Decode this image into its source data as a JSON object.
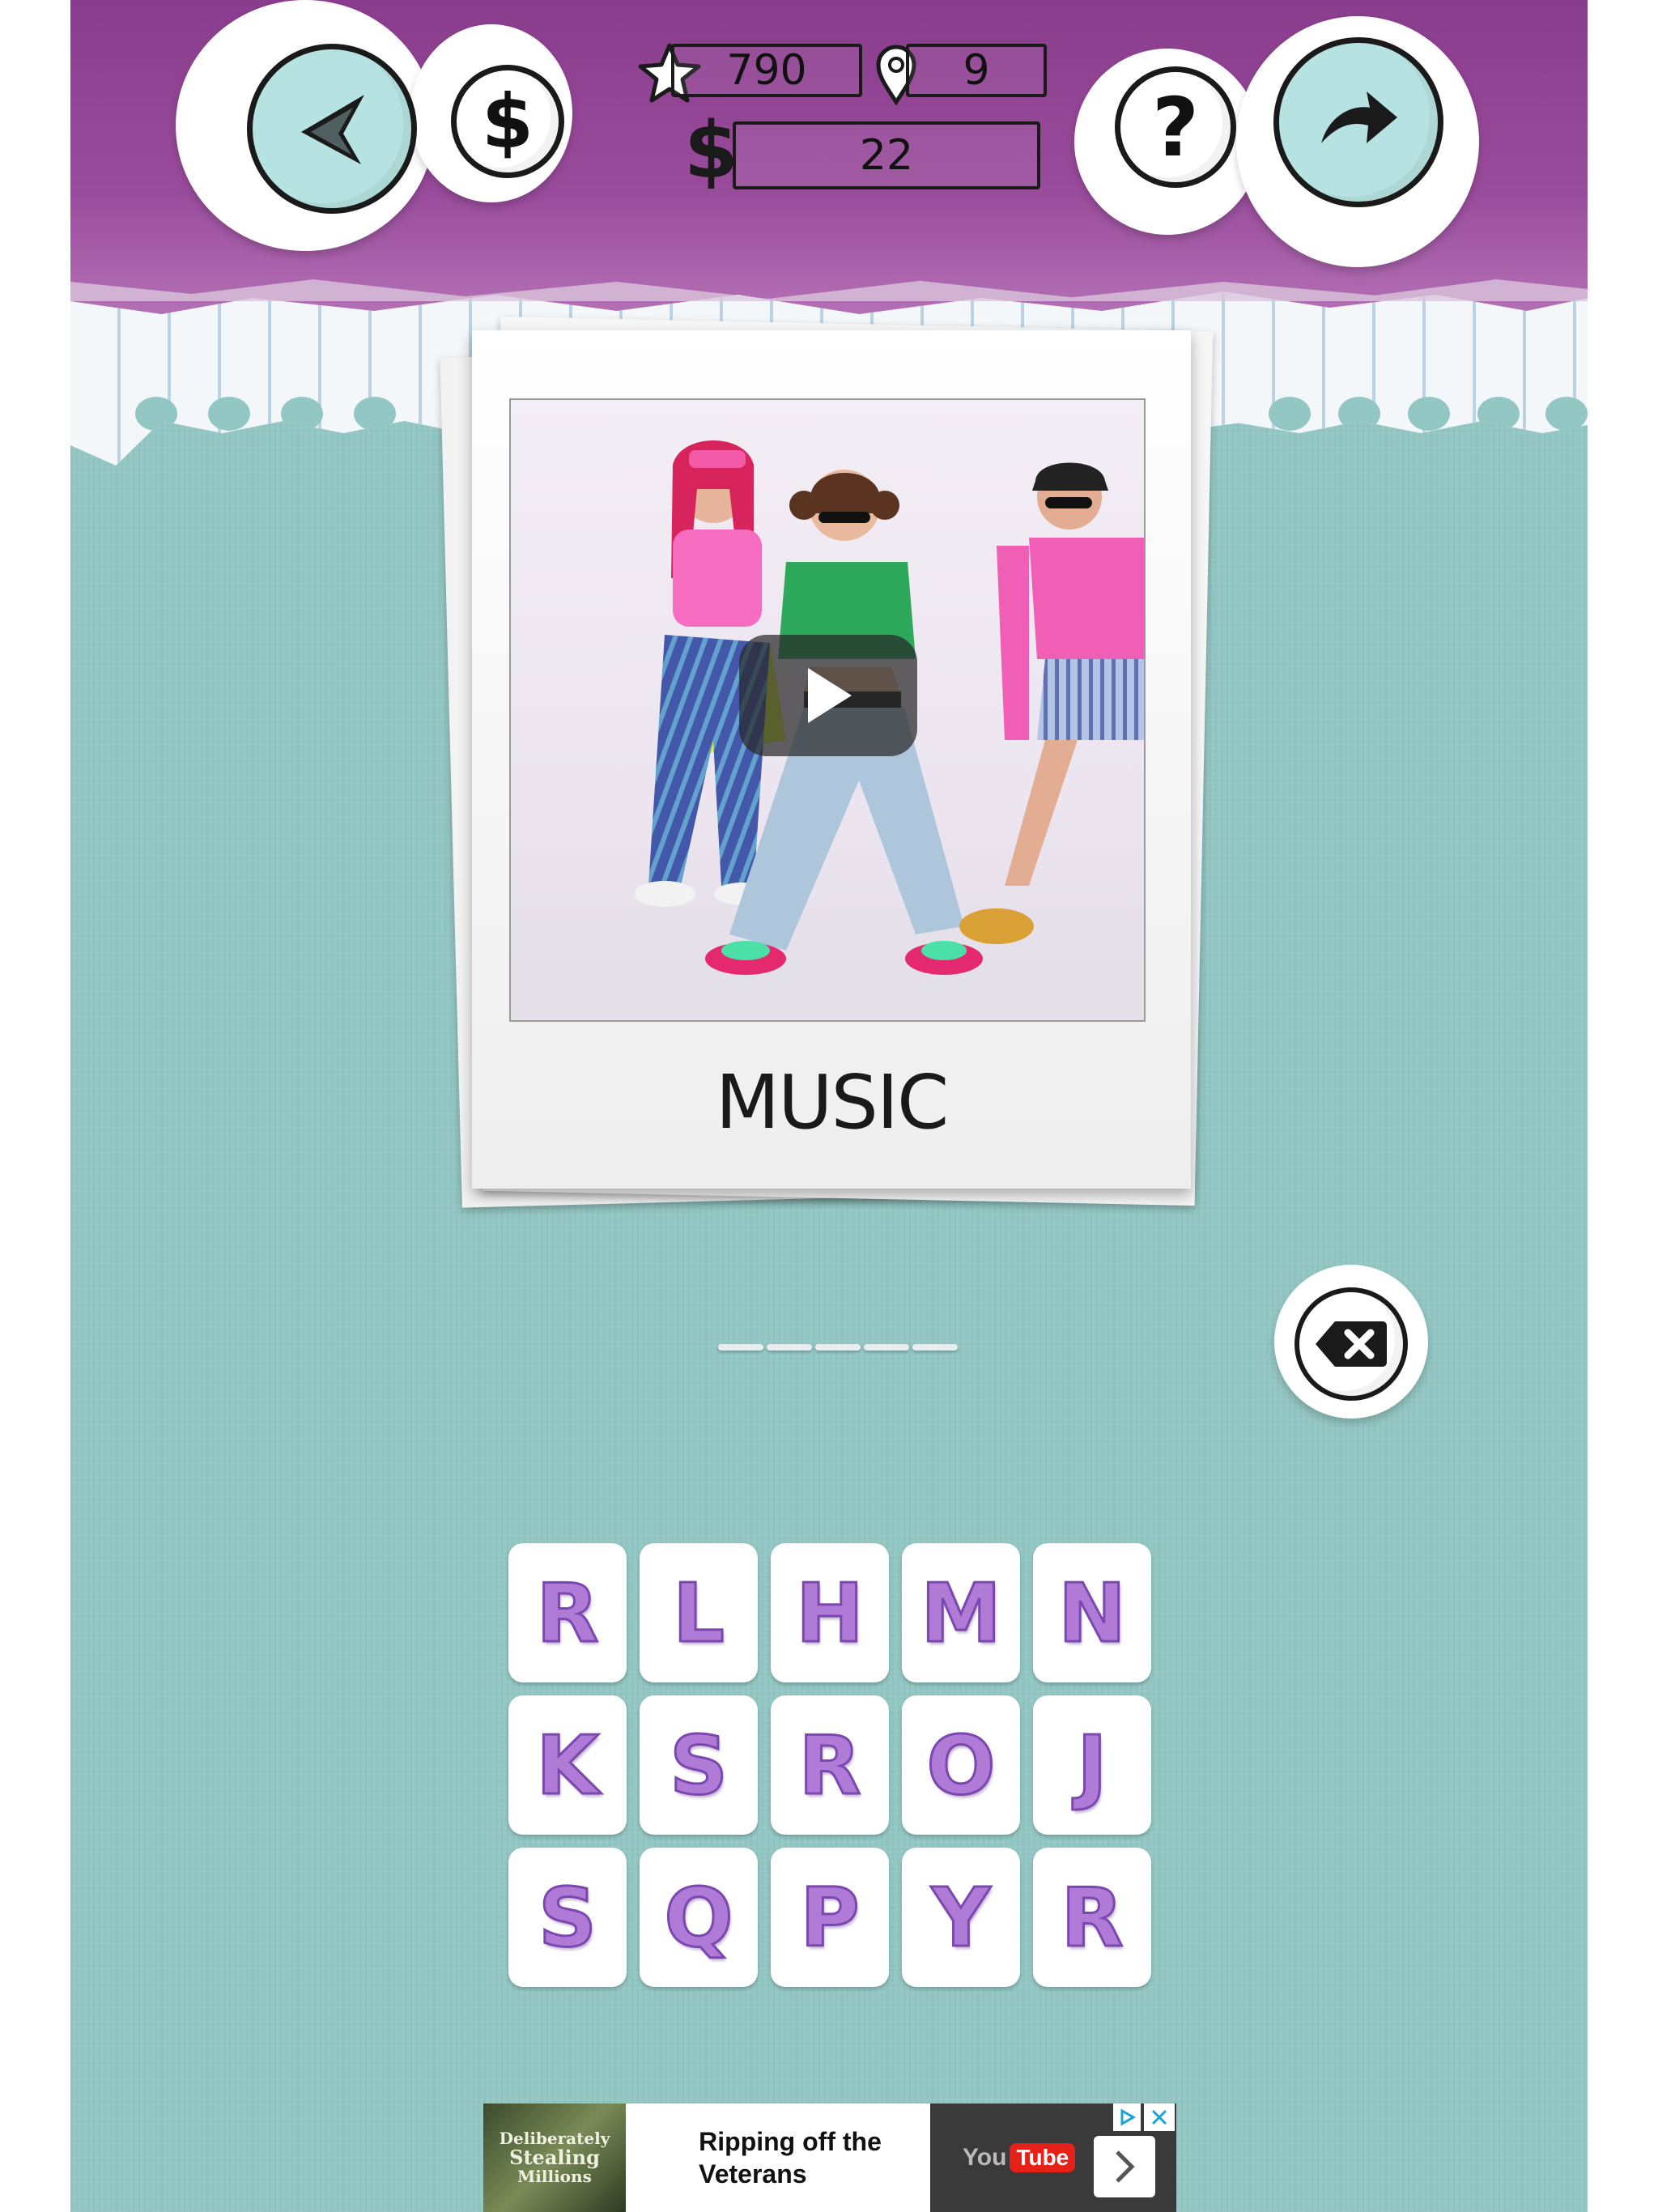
{
  "header": {
    "score": "790",
    "level": "9",
    "coins": "22",
    "coin_symbol": "$",
    "help_symbol": "?"
  },
  "puzzle": {
    "caption": "MUSIC",
    "answer_length": 5
  },
  "letters": [
    "R",
    "L",
    "H",
    "M",
    "N",
    "K",
    "S",
    "R",
    "O",
    "J",
    "S",
    "Q",
    "P",
    "Y",
    "R"
  ],
  "ad": {
    "thumb_lines": [
      "Deliberately",
      "Stealing",
      "Millions"
    ],
    "headline_line1": "Ripping off the",
    "headline_line2": "Veterans",
    "brand_you": "You",
    "brand_tube": "Tube"
  },
  "colors": {
    "header_purple": "#8a3c8d",
    "background_teal": "#93c7c3",
    "tile_letter": "#b07bd6",
    "button_teal": "#b6e3e1"
  }
}
